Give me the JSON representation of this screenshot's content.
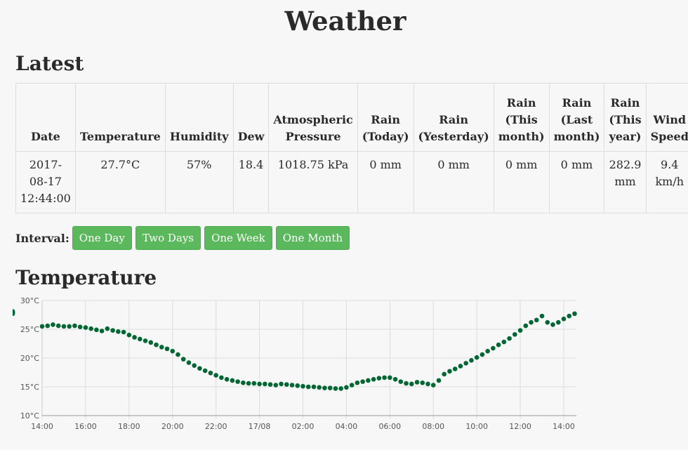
{
  "page_title": "Weather",
  "latest": {
    "title": "Latest",
    "headers": [
      "Date",
      "Temperature",
      "Humidity",
      "Dew",
      "Atmospheric Pressure",
      "Rain (Today)",
      "Rain (Yesterday)",
      "Rain (This month)",
      "Rain (Last month)",
      "Rain (This year)",
      "Wind Speed"
    ],
    "values": [
      "2017-08-17 12:44:00",
      "27.7°C",
      "57%",
      "18.4",
      "1018.75 kPa",
      "0 mm",
      "0 mm",
      "0 mm",
      "0 mm",
      "282.9 mm",
      "9.4 km/h"
    ]
  },
  "interval": {
    "label": "Interval:",
    "buttons": [
      "One Day",
      "Two Days",
      "One Week",
      "One Month"
    ]
  },
  "temperature": {
    "title": "Temperature"
  },
  "chart_data": {
    "type": "scatter",
    "title": "",
    "xlabel": "",
    "ylabel": "",
    "ylim": [
      10,
      30
    ],
    "y_ticks": [
      "10°C",
      "15°C",
      "20°C",
      "25°C",
      "30°C"
    ],
    "x_ticks": [
      "14:00",
      "16:00",
      "18:00",
      "20:00",
      "22:00",
      "17/08",
      "02:00",
      "04:00",
      "06:00",
      "08:00",
      "10:00",
      "12:00",
      "14:00"
    ],
    "grid": true,
    "color": "#006633",
    "series": [
      {
        "x_hours": [
          0.0,
          0.25,
          0.5,
          0.75,
          1.0,
          1.25,
          1.5,
          1.75,
          2.0,
          2.25,
          2.5,
          2.75,
          3.0,
          3.25,
          3.5,
          3.75,
          4.0,
          4.25,
          4.5,
          4.75,
          5.0,
          5.25,
          5.5,
          5.75,
          6.0,
          6.25,
          6.5,
          6.75,
          7.0,
          7.25,
          7.5,
          7.75,
          8.0,
          8.25,
          8.5,
          8.75,
          9.0,
          9.25,
          9.5,
          9.75,
          10.0,
          10.25,
          10.5,
          10.75,
          11.0,
          11.25,
          11.5,
          11.75,
          12.0,
          12.25,
          12.5,
          12.75,
          13.0,
          13.25,
          13.5,
          13.75,
          14.0,
          14.25,
          14.5,
          14.75,
          15.0,
          15.25,
          15.5,
          15.75,
          16.0,
          16.25,
          16.5,
          16.75,
          17.0,
          17.25,
          17.5,
          17.75,
          18.0,
          18.25,
          18.5,
          18.75,
          19.0,
          19.25,
          19.5,
          19.75,
          20.0,
          20.25,
          20.5,
          20.75,
          21.0,
          21.25,
          21.5,
          21.75,
          22.0,
          22.25,
          22.5,
          22.75,
          23.0,
          23.25,
          23.5,
          23.75,
          24.0,
          24.25,
          24.5
        ],
        "values": [
          25.5,
          25.6,
          25.8,
          25.6,
          25.5,
          25.5,
          25.6,
          25.4,
          25.3,
          25.1,
          24.9,
          24.7,
          25.1,
          24.8,
          24.6,
          24.5,
          24.0,
          23.6,
          23.3,
          23.0,
          22.7,
          22.3,
          21.9,
          21.6,
          21.2,
          20.6,
          19.8,
          19.2,
          18.7,
          18.2,
          17.8,
          17.4,
          17.0,
          16.6,
          16.3,
          16.1,
          15.9,
          15.7,
          15.6,
          15.6,
          15.5,
          15.5,
          15.4,
          15.3,
          15.5,
          15.4,
          15.3,
          15.2,
          15.1,
          15.0,
          15.0,
          14.9,
          14.8,
          14.8,
          14.7,
          14.7,
          14.9,
          15.3,
          15.7,
          15.9,
          16.1,
          16.3,
          16.5,
          16.6,
          16.6,
          16.3,
          15.9,
          15.6,
          15.5,
          15.8,
          15.7,
          15.5,
          15.3,
          16.1,
          17.2,
          17.7,
          18.1,
          18.6,
          19.1,
          19.6,
          20.1,
          20.6,
          21.2,
          21.7,
          22.3,
          22.8,
          23.4,
          24.1,
          24.8,
          25.6,
          26.2,
          26.6,
          27.3,
          26.2,
          25.8,
          26.2,
          26.8,
          27.3,
          27.7,
          28.0,
          28.1,
          27.9,
          27.8,
          27.7
        ]
      }
    ]
  }
}
